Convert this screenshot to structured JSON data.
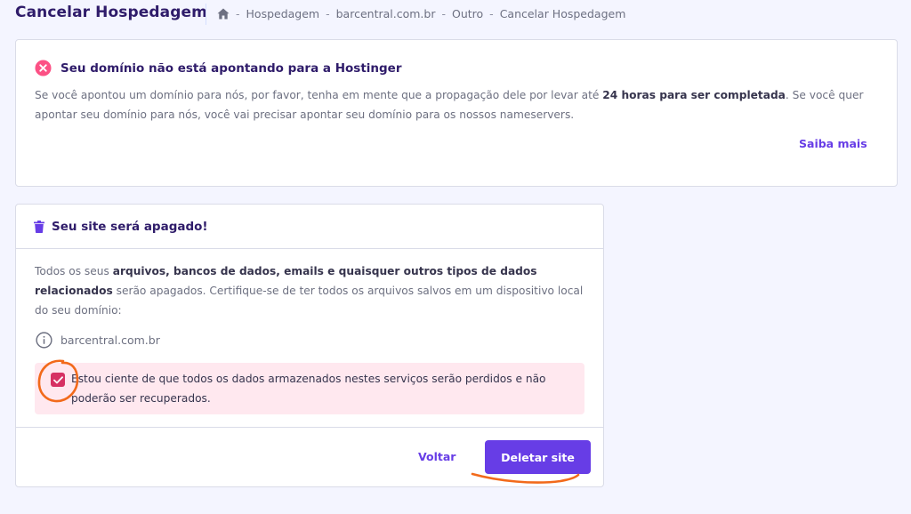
{
  "header": {
    "title": "Cancelar Hospedagem",
    "breadcrumb": {
      "home_icon": "home-icon",
      "separator": "-",
      "items": [
        "Hospedagem",
        "barcentral.com.br",
        "Outro",
        "Cancelar Hospedagem"
      ]
    }
  },
  "alert": {
    "icon": "error-circle-icon",
    "title": "Seu domínio não está apontando para a Hostinger",
    "body_part1": "Se você apontou um domínio para nós, por favor, tenha em mente que a propagação dele por levar até ",
    "body_bold": "24 horas para ser completada",
    "body_part2": ". Se você quer apontar seu domínio para nós, você vai precisar apontar seu domínio para os nossos nameservers.",
    "link_label": "Saiba mais"
  },
  "delete_card": {
    "icon": "trash-icon",
    "title": "Seu site será apagado!",
    "body_part1": "Todos os seus ",
    "body_bold": "arquivos, bancos de dados, emails e quaisquer outros tipos de dados relacionados",
    "body_part2": " serão apagados. Certifique-se de ter todos os arquivos salvos em um dispositivo local do seu domínio:",
    "domain_icon": "info-icon",
    "domain": "barcentral.com.br",
    "confirm_checked": true,
    "confirm_text": "Estou ciente de que todos os dados armazenados nestes serviços serão perdidos e não poderão ser recuperados.",
    "back_label": "Voltar",
    "delete_label": "Deletar site"
  },
  "colors": {
    "accent": "#673de6",
    "title": "#2f1c6a",
    "error": "#fc5185",
    "confirm_bg": "#ffe8ef",
    "checkbox": "#d63163",
    "annotation": "#f26a1b"
  }
}
